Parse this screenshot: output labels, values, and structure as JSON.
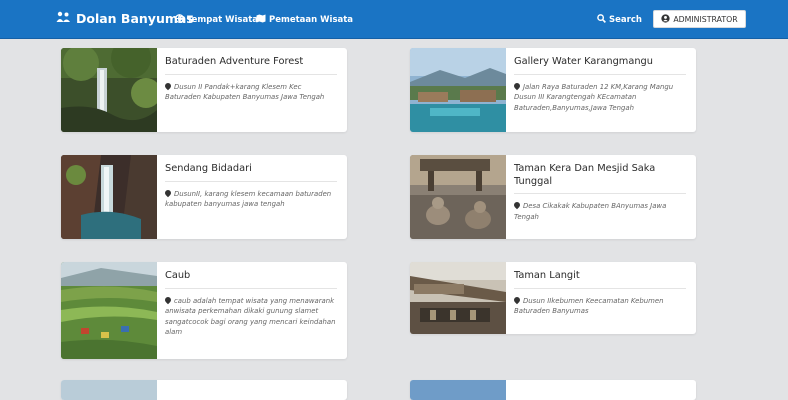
{
  "navbar": {
    "brand": "Dolan Banyumas",
    "links": [
      "Tempat Wisata",
      "Pemetaan Wisata"
    ],
    "search": "Search",
    "user": "ADMINISTRATOR"
  },
  "places": [
    {
      "title": "Baturaden Adventure Forest",
      "address": "Dusun II Pandak+karang Klesem Kec Baturaden Kabupaten Banyumas Jawa Tengah"
    },
    {
      "title": "Gallery Water Karangmangu",
      "address": "Jalan Raya Baturaden 12 KM,Karang Mangu Dusun III Karangtengah KEcamatan Baturaden,Banyumas,Jawa Tengah"
    },
    {
      "title": "Sendang Bidadari",
      "address": "DusunII, karang klesem kecamaan baturaden kabupaten banyumas jawa tengah"
    },
    {
      "title": "Taman Kera Dan Mesjid Saka Tunggal",
      "address": "Desa Cikakak Kabupaten BAnyumas Jawa Tengah"
    },
    {
      "title": "Caub",
      "address": "caub adalah tempat wisata yang menawarank anwisata perkemahan dikaki gunung slamet sangatcocok bagi orang yang mencari keindahan alam"
    },
    {
      "title": "Taman Langit",
      "address": "Dusun IIkebumen Keecamatan Kebumen Baturaden Banyumas"
    }
  ],
  "colors": {
    "navbar": "#1a74c4",
    "background": "#e2e3e5",
    "card": "#ffffff"
  },
  "icons": {
    "brand": "people-icon",
    "places": "globe-icon",
    "map": "map-icon",
    "search": "search-icon",
    "user": "user-circle-icon",
    "address": "map-pin-icon"
  }
}
